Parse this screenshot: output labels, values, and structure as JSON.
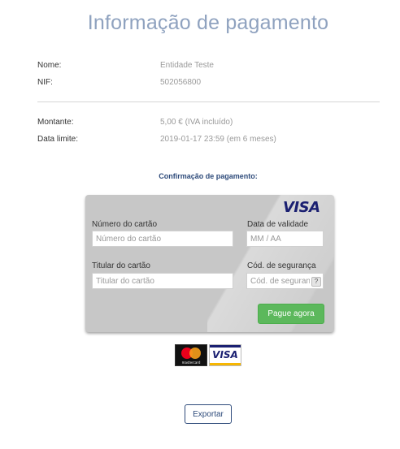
{
  "title": "Informação de pagamento",
  "details": {
    "name_label": "Nome:",
    "name_value": "Entidade Teste",
    "nif_label": "NIF:",
    "nif_value": "502056800",
    "amount_label": "Montante:",
    "amount_value": "5,00 € (IVA incluído)",
    "deadline_label": "Data limite:",
    "deadline_value": "2019-01-17 23:59 (em 6 meses)"
  },
  "confirmation_heading": "Confirmação de pagamento:",
  "card_form": {
    "brand": "VISA",
    "card_number_label": "Número do cartão",
    "card_number_placeholder": "Número do cartão",
    "expiry_label": "Data de validade",
    "expiry_placeholder": "MM / AA",
    "holder_label": "Titular do cartão",
    "holder_placeholder": "Titular do cartão",
    "cvv_label": "Cód. de segurança",
    "cvv_placeholder": "Cód. de segurança",
    "cvv_help": "?",
    "pay_button": "Pague agora"
  },
  "brands": {
    "mastercard_text": "mastercard",
    "visa_text": "VISA"
  },
  "export_button": "Exportar",
  "colors": {
    "title": "#8fa2bf",
    "heading": "#2d4a7a",
    "pay_button": "#5cb85c"
  }
}
